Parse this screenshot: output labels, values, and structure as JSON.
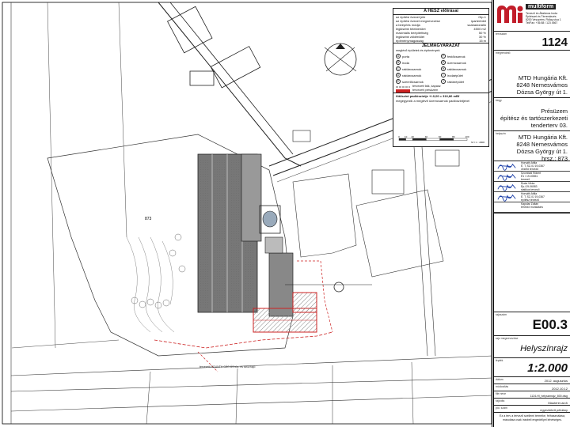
{
  "hesz": {
    "title": "A HÉSZ előírásai",
    "rows": [
      {
        "label": "az építési övezet jele",
        "value": "Gip-1"
      },
      {
        "label": "az építési övezet megnevezése",
        "value": "ipartertület"
      },
      {
        "label": "a beépítés módja",
        "value": "szabadonálló"
      },
      {
        "label": "legkisebb telekterület",
        "value": "4500 m2"
      },
      {
        "label": "maximális beépítettség",
        "value": "50 %"
      },
      {
        "label": "legkisebb zöldfelület",
        "value": "30 %"
      },
      {
        "label": "építménymagasság",
        "value": "15 m"
      }
    ]
  },
  "legend": {
    "title": "JELMAGYARÁZAT",
    "subtitle": "meglévő épületek és építmények",
    "items": [
      {
        "num": "A",
        "label": "porta"
      },
      {
        "num": "F",
        "label": "festőcsarnok"
      },
      {
        "num": "B",
        "label": "iroda"
      },
      {
        "num": "G",
        "label": "üzemcsarnok"
      },
      {
        "num": "C",
        "label": "raktárcsarnok"
      },
      {
        "num": "H",
        "label": "raktárcsarnok"
      },
      {
        "num": "D",
        "label": "raktárcsarnok"
      },
      {
        "num": "I",
        "label": "irodaépület"
      },
      {
        "num": "E",
        "label": "szerelőcsarnok"
      },
      {
        "num": "J",
        "label": "raktárépület"
      }
    ],
    "line_note": "tervezett falk, kapasz",
    "planned_note": "tervezett présüzem",
    "datum": "fötőszint padlószintje  +/-0,00 = 316,86 mBf",
    "datum2": "megegyezik a meglévő üzemcsarnok padlószintjével",
    "scale_ticks": [
      "0",
      "10",
      "20",
      "40",
      "60",
      "80",
      "100"
    ],
    "scale_unit": "M = 1 : 2000"
  },
  "site": {
    "lot_label": "873",
    "annotation": "tervezett ROUNTH GÁS ÚS  tűz- és tározhajó"
  },
  "title_block": {
    "logo_text": "multiform",
    "logo_small": [
      "Tervező és Általános Iroda",
      "Építészet és Térrendezés",
      "8200 Veszprém, Fidlay utca 1",
      "Tel/Fax: +36 88 / 123 4567"
    ],
    "project_no_label": "tervszám",
    "project_no": "1124",
    "client_label": "megrendelő",
    "client": [
      "MTD Hungária Kft.",
      "8248 Nemesvámos",
      "Dózsa György út 1."
    ],
    "object_label": "tárgy",
    "object": [
      "Présüzem",
      "építész és tartószerkezeti",
      "tenderterv 03."
    ],
    "site_label": "helyszín",
    "site": [
      "MTD Hungária Kft.",
      "8248 Nemesvámos",
      "Dózsa György út 1.",
      "hrsz.: 873"
    ],
    "signatures": [
      {
        "name": "Horváth Attila",
        "role": "É, T, SZ-/Ü 19-0367",
        "role2": "vezető tervező"
      },
      {
        "name": "Szombati Róbert",
        "role": "É1 / 19-00551",
        "role2": "tervező"
      },
      {
        "name": "Ruda Viktor",
        "role": "Ép-/19-06083",
        "role2": "statikus tervező"
      },
      {
        "name": "Horváth Attila",
        "role": "É, T, SZ-/Ü 19-0367",
        "role2": "építész tervező"
      },
      {
        "name": "Kapolar Zoltán",
        "role": "tervező munkatárs",
        "role2": ""
      }
    ],
    "sheet_label": "rajzszám",
    "sheet_no": "E00.3",
    "drawing_label": "rajz megnevezése",
    "drawing_name": "Helyszínrajz",
    "scale_label": "lépték",
    "scale": "1:2.000",
    "date_label": "dátum",
    "date": "2012. augusztus",
    "revision_label": "módosítás",
    "revision": "2012.10.12",
    "file_label": "file neve",
    "file": "1124-Hl_helyszinrajz_800.dwg",
    "drawn_label": "rajzolta",
    "drawn": "Mauterer.arch",
    "copy_label": "pld. szám",
    "copy": "egyeztetett példány",
    "bottom_note": "Ez a terv a tervező szellemi terméke, felhasználása, másolása csak írásbeli engedéllyel lehetséges."
  }
}
